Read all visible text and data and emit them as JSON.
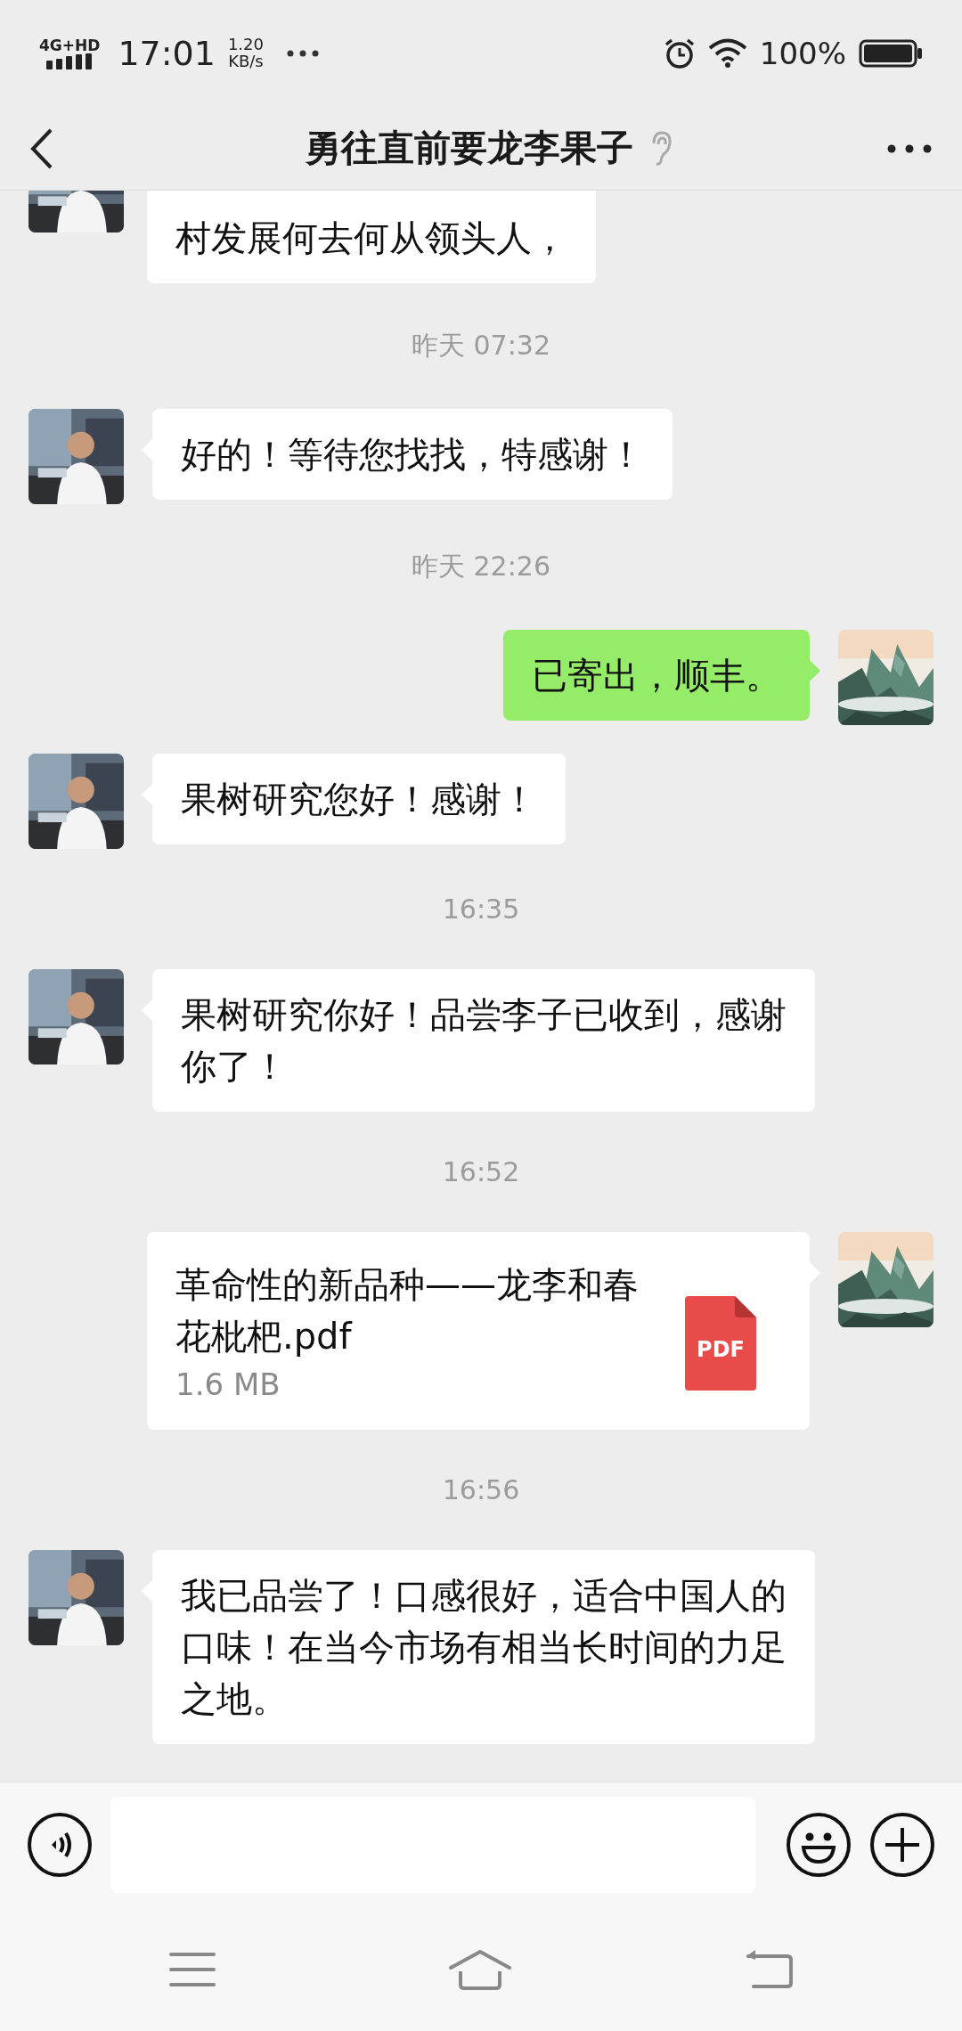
{
  "status_bar": {
    "network": "4G+HD",
    "time": "17:01",
    "speed_value": "1.20",
    "speed_unit": "KB/s",
    "battery": "100%"
  },
  "header": {
    "title": "勇往直前要龙李果子"
  },
  "messages": [
    {
      "kind": "text",
      "outgoing": false,
      "clipped": true,
      "text": "村发展何去何从领头人，"
    },
    {
      "kind": "time",
      "text": "昨天 07:32"
    },
    {
      "kind": "text",
      "outgoing": false,
      "text": "好的！等待您找找，特感谢！"
    },
    {
      "kind": "time",
      "text": "昨天 22:26"
    },
    {
      "kind": "text",
      "outgoing": true,
      "text": "已寄出，顺丰。"
    },
    {
      "kind": "text",
      "outgoing": false,
      "text": "果树研究您好！感谢！"
    },
    {
      "kind": "time",
      "text": "16:35"
    },
    {
      "kind": "text",
      "outgoing": false,
      "text": "果树研究你好！品尝李子已收到，感谢你了！"
    },
    {
      "kind": "time",
      "text": "16:52"
    },
    {
      "kind": "file",
      "outgoing": true,
      "name": "革命性的新品种——龙李和春花枇杷.pdf",
      "size": "1.6 MB",
      "icon_label": "PDF"
    },
    {
      "kind": "time",
      "text": "16:56"
    },
    {
      "kind": "text",
      "outgoing": false,
      "text": "我已品尝了！口感很好，适合中国人的口味！在当今市场有相当长时间的力足之地。"
    }
  ]
}
